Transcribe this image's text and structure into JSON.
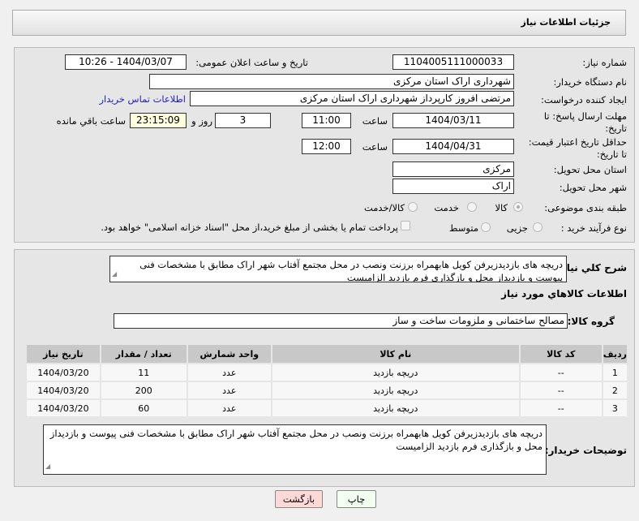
{
  "header": {
    "title": "جزئیات اطلاعات نیاز"
  },
  "form": {
    "need_number_label": "شماره نیاز:",
    "need_number": "1104005111000033",
    "announce_label": "تاریخ و ساعت اعلان عمومی:",
    "announce_value": "1404/03/07 - 10:26",
    "buyer_org_label": "نام دستگاه خریدار:",
    "buyer_org": "شهرداری اراک استان مرکزی",
    "creator_label": "ایجاد کننده درخواست:",
    "creator": "مرتضی افروز کارپرداز شهرداری اراک استان مرکزی",
    "contact_link": "اطلاعات تماس خریدار",
    "deadline_label": "مهلت ارسال پاسخ: تا تاریخ:",
    "deadline_date": "1404/03/11",
    "time_label": "ساعت",
    "deadline_time": "11:00",
    "days": "3",
    "days_label": "روز و",
    "remaining": "23:15:09",
    "remaining_label": "ساعت باقي مانده",
    "validity_label": "حداقل تاریخ اعتبار قیمت: تا تاریخ:",
    "validity_date": "1404/04/31",
    "validity_time": "12:00",
    "province_label": "استان محل تحویل:",
    "province": "مرکزی",
    "city_label": "شهر محل تحویل:",
    "city": "اراک",
    "category_label": "طبقه بندی موضوعی:",
    "category_options": [
      "کالا",
      "خدمت",
      "کالا/خدمت"
    ],
    "category_selected": "کالا",
    "process_label": "نوع فرآیند خرید :",
    "process_options": [
      "جزیی",
      "متوسط"
    ],
    "payment_note": "پرداخت تمام یا بخشی از مبلغ خرید،از محل \"اسناد خزانه اسلامی\" خواهد بود."
  },
  "details": {
    "desc_label": "شرح کلي نياز:",
    "desc": "دریچه های بازدیدزیرفن کویل هابهمراه برزنت ونصب در محل مجتمع آفتاب شهر اراک مطابق با مشخصات فنی پیوست و بازدیداز محل و بازگذاری فرم بازدید الزامیست",
    "goods_title": "اطلاعات كالاهاي مورد نياز",
    "group_label": "گروه کالا:",
    "group": "مصالح ساختمانی و ملزومات ساخت و ساز",
    "table": {
      "headers": [
        "ردیف",
        "کد کالا",
        "نام کالا",
        "واحد شمارش",
        "تعداد / مقدار",
        "تاریخ نیاز"
      ],
      "rows": [
        [
          "1",
          "--",
          "دریچه بازدید",
          "عدد",
          "11",
          "1404/03/20"
        ],
        [
          "2",
          "--",
          "دریچه بازدید",
          "عدد",
          "200",
          "1404/03/20"
        ],
        [
          "3",
          "--",
          "دریچه بازدید",
          "عدد",
          "60",
          "1404/03/20"
        ]
      ]
    },
    "buyer_notes_label": "توضیحات خریدار:",
    "buyer_notes": "دریچه های بازدیدزیرفن کویل هابهمراه برزنت ونصب در محل مجتمع آفتاب شهر اراک مطابق با مشخصات فنی پیوست و بازدیداز محل و بازگذاری فرم بازدید الزامیست"
  },
  "buttons": {
    "print": "چاپ",
    "back": "بازگشت"
  }
}
